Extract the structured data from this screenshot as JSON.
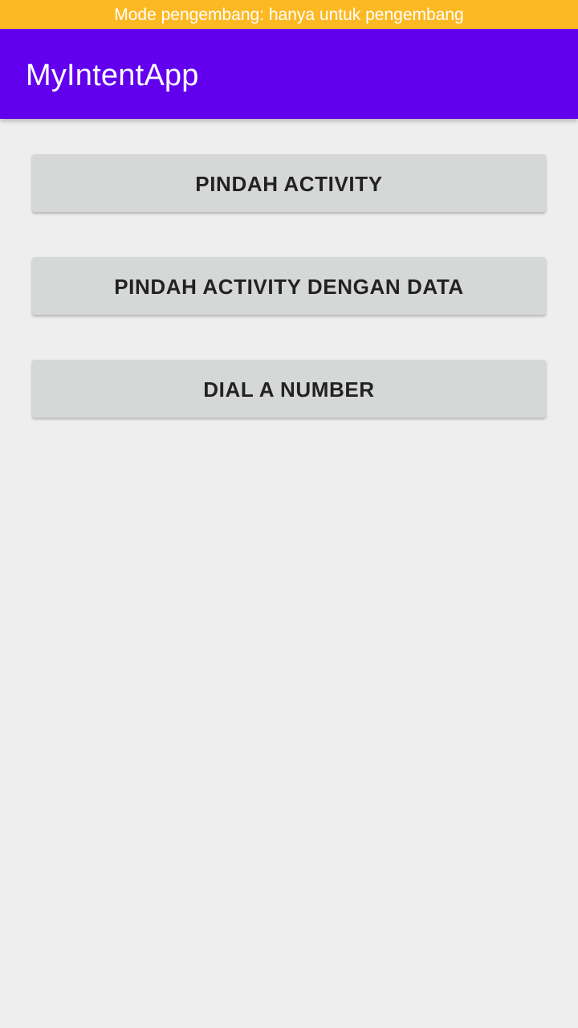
{
  "dev_banner": {
    "text": "Mode pengembang: hanya untuk pengembang",
    "color": "#fdb924"
  },
  "app_bar": {
    "title": "MyIntentApp",
    "color": "#6200ee"
  },
  "buttons": [
    {
      "label": "PINDAH ACTIVITY"
    },
    {
      "label": "PINDAH ACTIVITY DENGAN DATA"
    },
    {
      "label": "DIAL A NUMBER"
    }
  ],
  "colors": {
    "background": "#eeeeee",
    "button": "#d6d7d7",
    "button_text": "#222222"
  }
}
